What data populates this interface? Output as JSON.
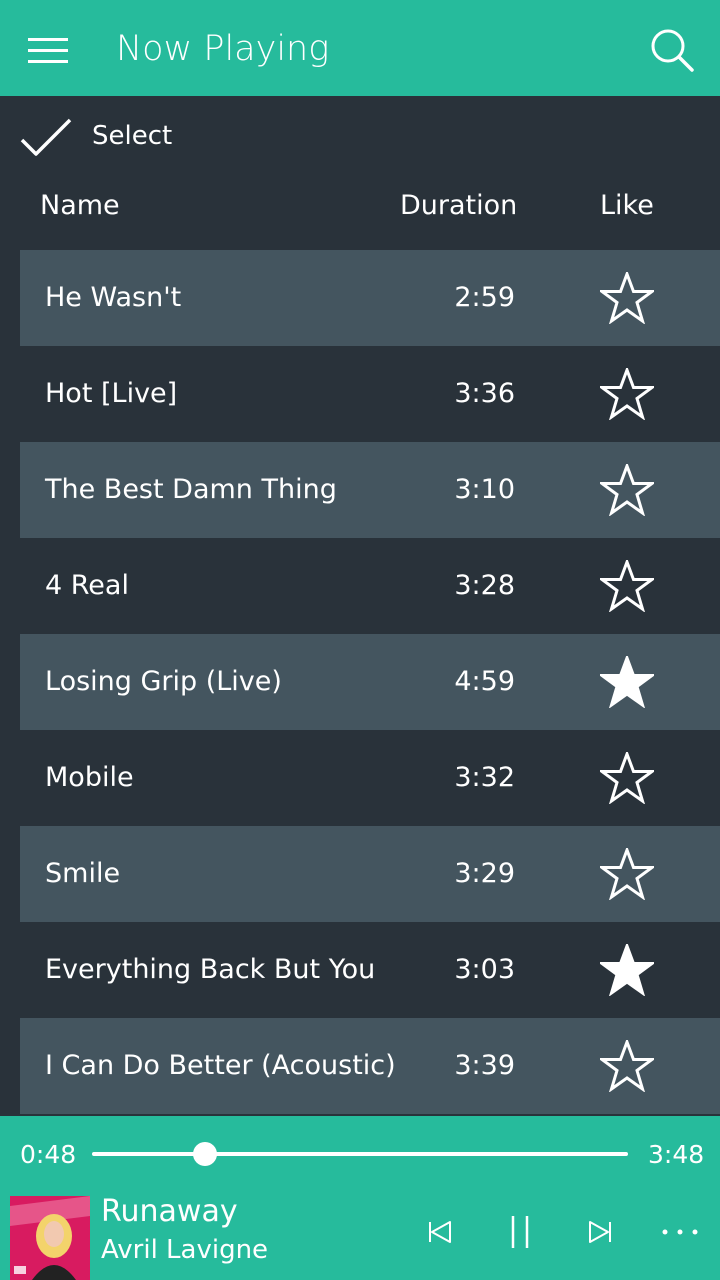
{
  "header": {
    "title": "Now Playing",
    "menu_icon": "hamburger-menu-icon",
    "search_icon": "search-icon",
    "background": "#26bb9c"
  },
  "select": {
    "label": "Select",
    "icon": "checkmark-icon"
  },
  "columns": {
    "name": "Name",
    "duration": "Duration",
    "like": "Like"
  },
  "songs": [
    {
      "name": "He Wasn't",
      "duration": "2:59",
      "liked": false
    },
    {
      "name": "Hot [Live]",
      "duration": "3:36",
      "liked": false
    },
    {
      "name": "The Best Damn Thing",
      "duration": "3:10",
      "liked": false
    },
    {
      "name": "4 Real",
      "duration": "3:28",
      "liked": false
    },
    {
      "name": "Losing Grip (Live)",
      "duration": "4:59",
      "liked": true
    },
    {
      "name": "Mobile",
      "duration": "3:32",
      "liked": false
    },
    {
      "name": "Smile",
      "duration": "3:29",
      "liked": false
    },
    {
      "name": "Everything Back But You",
      "duration": "3:03",
      "liked": true
    },
    {
      "name": "I Can Do Better (Acoustic)",
      "duration": "3:39",
      "liked": false
    }
  ],
  "player": {
    "current_time": "0:48",
    "total_time": "3:48",
    "progress": 0.21,
    "track_title": "Runaway",
    "artist": "Avril Lavigne",
    "controls": [
      "previous-icon",
      "pause-icon",
      "next-icon",
      "more-icon"
    ],
    "accent": "#26bb9c"
  },
  "colors": {
    "background": "#29323a",
    "row_alt": "#44555f",
    "text": "#ffffff"
  }
}
